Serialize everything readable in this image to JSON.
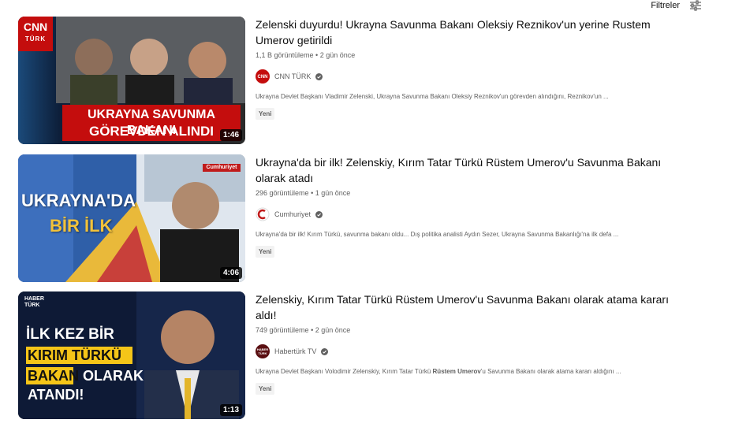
{
  "filters": {
    "label": "Filtreler",
    "icon": "sliders-icon"
  },
  "results": [
    {
      "title": "Zelenski duyurdu! Ukrayna Savunma Bakanı Oleksiy Reznikov'un yerine Rustem Umerov getirildi",
      "views": "1,1 B görüntüleme",
      "age": "2 gün önce",
      "channel": "CNN TÜRK",
      "description": "Ukrayna Devlet Başkanı Vladimir Zelenski, Ukrayna Savunma Bakanı Oleksiy Reznikov'un görevden alındığını, Reznikov'un ...",
      "badge": "Yeni",
      "duration": "1:46",
      "thumb_text": {
        "logo": "CNN",
        "logo_sub": "TÜRK",
        "line1": "UKRAYNA SAVUNMA BAKANI",
        "line2": "GÖREVDEN ALINDI"
      }
    },
    {
      "title": "Ukrayna'da bir ilk! Zelenskiy, Kırım Tatar Türkü Rüstem Umerov'u Savunma Bakanı olarak atadı",
      "views": "296 görüntüleme",
      "age": "1 gün önce",
      "channel": "Cumhuriyet",
      "description": "Ukrayna'da bir ilk! Kırım Türkü, savunma bakanı oldu... Dış politika analisti Aydın Sezer, Ukrayna Savunma Bakanlığı'na ilk defa ...",
      "badge": "Yeni",
      "duration": "4:06",
      "thumb_text": {
        "logo": "Cumhuriyet",
        "line1": "UKRAYNA'DA",
        "line2": "BİR İLK"
      }
    },
    {
      "title": "Zelenskiy, Kırım Tatar Türkü Rüstem Umerov'u Savunma Bakanı olarak atama kararı aldı!",
      "views": "749 görüntüleme",
      "age": "2 gün önce",
      "channel": "Habertürk TV",
      "description_pre": "Ukrayna Devlet Başkanı Volodimir Zelenskiy, Kırım Tatar Türkü ",
      "description_bold": "Rüstem Umerov",
      "description_post": "'u Savunma Bakanı olarak atama kararı aldığını ...",
      "badge": "Yeni",
      "duration": "1:13",
      "thumb_text": {
        "logo": "HABER",
        "logo_sub": "TÜRK",
        "line1": "İLK KEZ BİR",
        "line2": "KIRIM TÜRKÜ",
        "line3a": "BAKAN",
        "line3b": " OLARAK",
        "line4": "ATANDI!"
      }
    }
  ],
  "colors": {
    "text": "#0f0f0f",
    "meta": "#606060",
    "badge_bg": "#f2f2f2",
    "cnn_red": "#cc0000",
    "haber_yellow": "#f5c518"
  }
}
